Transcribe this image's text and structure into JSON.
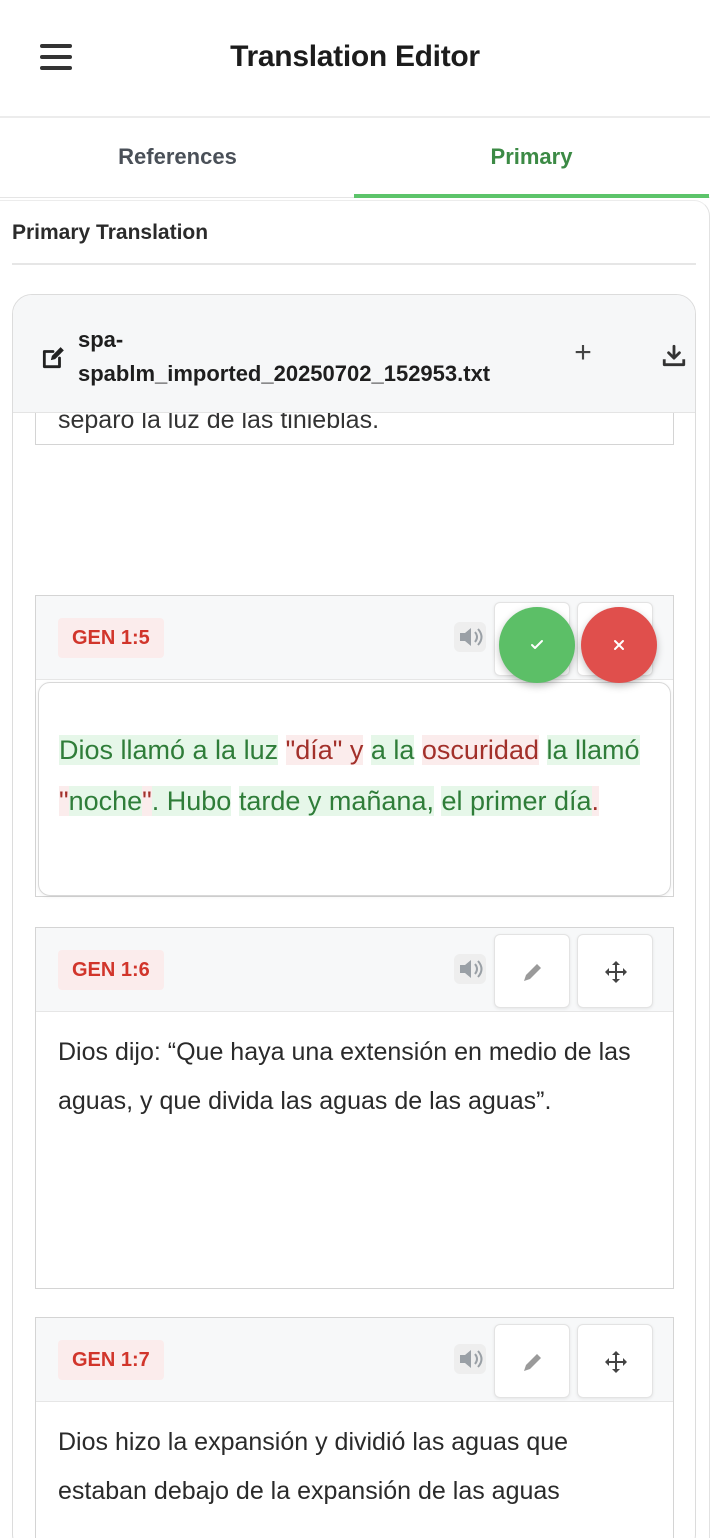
{
  "header": {
    "title": "Translation Editor",
    "menu_icon": "hamburger-menu-icon"
  },
  "tabs": [
    {
      "label": "References"
    },
    {
      "label": "Primary",
      "active": true
    }
  ],
  "section": {
    "title": "Primary Translation"
  },
  "document": {
    "name_line1": "spa-",
    "name_line2": "spablm_imported_20250702_152953.txt",
    "icons": [
      "edit-document-icon",
      "plus-icon",
      "download-icon"
    ]
  },
  "verses": {
    "prev": {
      "text": "separó la luz de las tinieblas."
    },
    "v5": {
      "ref": "GEN 1:5",
      "diff": [
        {
          "text": "Dios llamó a la ",
          "type": "add"
        },
        {
          "text": " ",
          "type": "plain"
        },
        {
          "text": "luz",
          "type": "add"
        },
        {
          "text": " ",
          "type": "plain"
        },
        {
          "text": "\"día\" y",
          "type": "del"
        },
        {
          "text": " ",
          "type": "plain"
        },
        {
          "text": "a la",
          "type": "add"
        },
        {
          "text": " ",
          "type": "plain"
        },
        {
          "text": "oscuridad",
          "type": "del"
        },
        {
          "text": " ",
          "type": "plain"
        },
        {
          "text": "la l",
          "type": "add"
        },
        {
          "text": "lamó",
          "type": "add"
        },
        {
          "text": " ",
          "type": "plain"
        },
        {
          "text": "\"",
          "type": "del"
        },
        {
          "text": "noche",
          "type": "add"
        },
        {
          "text": "\"",
          "type": "del"
        },
        {
          "text": ". Hubo",
          "type": "add"
        },
        {
          "text": " ",
          "type": "plain"
        },
        {
          "text": "tarde y mañana,",
          "type": "add"
        },
        {
          "text": " ",
          "type": "plain"
        },
        {
          "text": "el primer día",
          "type": "add"
        },
        {
          "text": ".",
          "type": "del"
        }
      ]
    },
    "v6": {
      "ref": "GEN 1:6",
      "text": "Dios dijo: “Que haya una extensión en medio de las aguas, y que divida las aguas de las aguas”."
    },
    "v7": {
      "ref": "GEN 1:7",
      "text": "Dios hizo la expansión y dividió las aguas que estaban debajo de la expansión de las aguas"
    }
  },
  "actions": {
    "accept_icon": "check-icon",
    "reject_icon": "close-icon"
  },
  "colors": {
    "accent": "#5cc46a",
    "added_bg": "#e6f7e9",
    "removed_bg": "#fbecec",
    "ref_badge_text": "#d1352b",
    "accept": "#5cbf67",
    "reject": "#e04f4c"
  }
}
